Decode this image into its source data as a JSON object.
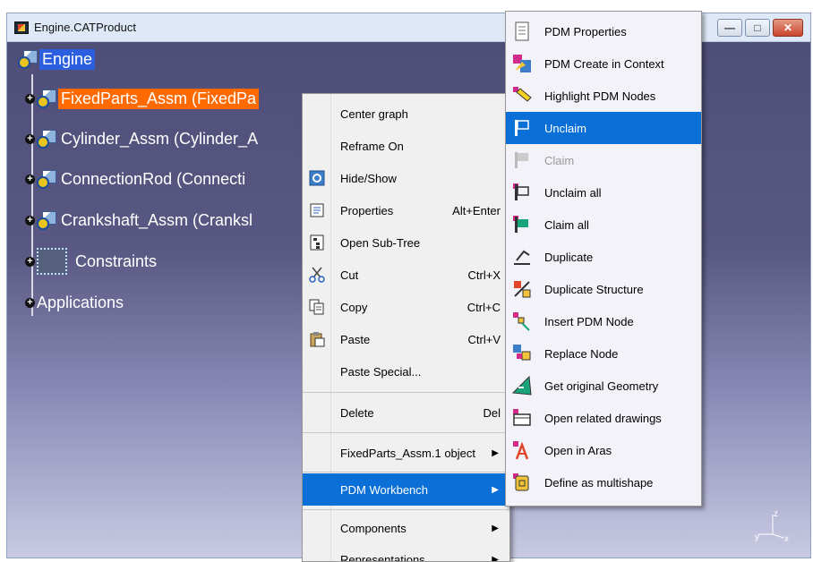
{
  "window": {
    "title": "Engine.CATProduct",
    "minimize": "—",
    "maximize": "□",
    "close": "✕"
  },
  "tree": {
    "root": "Engine",
    "nodes": [
      {
        "label": "FixedParts_Assm (FixedPa",
        "icon": "product-icon",
        "selected": true
      },
      {
        "label": "Cylinder_Assm (Cylinder_A",
        "icon": "product-icon",
        "selected": false
      },
      {
        "label": "ConnectionRod (Connecti",
        "icon": "product-icon",
        "selected": false
      },
      {
        "label": "Crankshaft_Assm (Cranksl",
        "icon": "product-icon",
        "selected": false
      },
      {
        "label": "Constraints",
        "icon": "constraints-icon",
        "selected": false
      }
    ],
    "applications": "Applications"
  },
  "context_menu": {
    "items": [
      {
        "label": "Center graph",
        "shortcut": "",
        "icon": ""
      },
      {
        "label": "Reframe On",
        "shortcut": "",
        "icon": ""
      },
      {
        "label": "Hide/Show",
        "shortcut": "",
        "icon": "hide-show-icon"
      },
      {
        "label": "Properties",
        "shortcut": "Alt+Enter",
        "icon": "properties-icon"
      },
      {
        "label": "Open Sub-Tree",
        "shortcut": "",
        "icon": "subtree-icon"
      },
      {
        "label": "Cut",
        "shortcut": "Ctrl+X",
        "icon": "cut-icon"
      },
      {
        "label": "Copy",
        "shortcut": "Ctrl+C",
        "icon": "copy-icon"
      },
      {
        "label": "Paste",
        "shortcut": "Ctrl+V",
        "icon": "paste-icon"
      },
      {
        "label": "Paste Special...",
        "shortcut": "",
        "icon": ""
      },
      {
        "label": "Delete",
        "shortcut": "Del",
        "icon": ""
      },
      {
        "label": "FixedParts_Assm.1 object",
        "shortcut": "",
        "icon": ""
      },
      {
        "label": "PDM Workbench",
        "shortcut": "",
        "icon": ""
      },
      {
        "label": "Components",
        "shortcut": "",
        "icon": ""
      },
      {
        "label": "Representations",
        "shortcut": "",
        "icon": ""
      }
    ]
  },
  "submenu": {
    "items": [
      {
        "label": "PDM Properties",
        "icon": "pdm-properties-icon",
        "state": "enabled"
      },
      {
        "label": "PDM Create in Context",
        "icon": "create-in-context-icon",
        "state": "enabled"
      },
      {
        "label": "Highlight PDM Nodes",
        "icon": "highlight-icon",
        "state": "enabled"
      },
      {
        "label": "Unclaim",
        "icon": "unclaim-icon",
        "state": "highlighted"
      },
      {
        "label": "Claim",
        "icon": "claim-icon",
        "state": "disabled"
      },
      {
        "label": "Unclaim all",
        "icon": "unclaim-all-icon",
        "state": "enabled"
      },
      {
        "label": "Claim all",
        "icon": "claim-all-icon",
        "state": "enabled"
      },
      {
        "label": "Duplicate",
        "icon": "duplicate-icon",
        "state": "enabled"
      },
      {
        "label": "Duplicate Structure",
        "icon": "duplicate-structure-icon",
        "state": "enabled"
      },
      {
        "label": "Insert PDM Node",
        "icon": "insert-node-icon",
        "state": "enabled"
      },
      {
        "label": "Replace Node",
        "icon": "replace-node-icon",
        "state": "enabled"
      },
      {
        "label": "Get original Geometry",
        "icon": "geometry-icon",
        "state": "enabled"
      },
      {
        "label": "Open related drawings",
        "icon": "drawings-icon",
        "state": "enabled"
      },
      {
        "label": "Open in Aras",
        "icon": "aras-icon",
        "state": "enabled"
      },
      {
        "label": "Define as multishape",
        "icon": "multishape-icon",
        "state": "enabled"
      }
    ]
  },
  "axis": {
    "y": "y",
    "z": "z",
    "x": "x"
  },
  "colors": {
    "selection": "#ff6a00",
    "root_highlight": "#2b5fe0",
    "menu_highlight": "#0a6fd6"
  }
}
